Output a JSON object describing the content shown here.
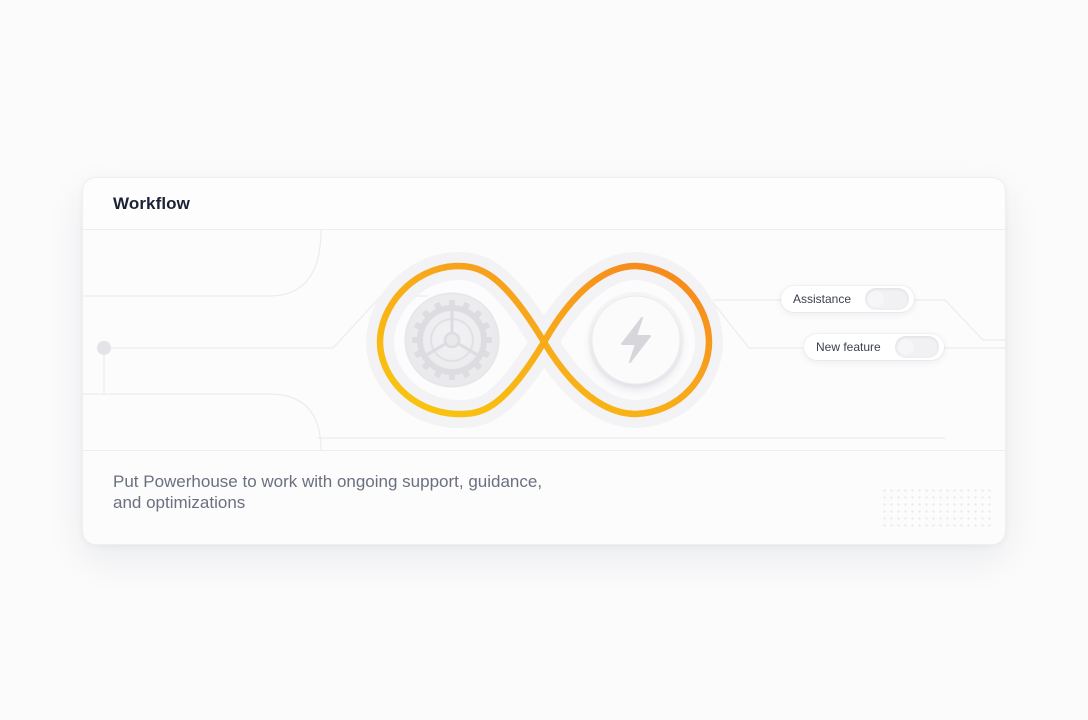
{
  "card": {
    "title": "Workflow",
    "description": "Put Powerhouse to work with ongoing support, guidance, and optimizations"
  },
  "toggles": [
    {
      "label": "Assistance",
      "enabled": false
    },
    {
      "label": "New feature",
      "enabled": false
    }
  ],
  "icons": {
    "left": "gear-icon",
    "right": "lightning-bolt-icon"
  },
  "colors": {
    "loop_start": "#f9c80e",
    "loop_end": "#f5841f",
    "card_bg": "#fcfcfd",
    "title": "#1c2233",
    "description": "#6b7080"
  }
}
